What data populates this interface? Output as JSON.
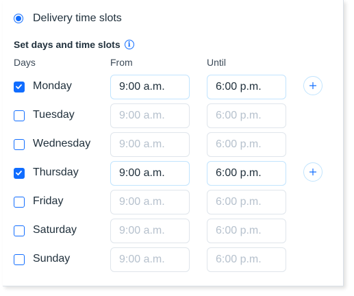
{
  "delivery": {
    "option_label": "Delivery time slots",
    "selected": true
  },
  "section": {
    "title": "Set days and time slots",
    "info_icon": "info-icon"
  },
  "columns": {
    "days": "Days",
    "from": "From",
    "until": "Until"
  },
  "days": [
    {
      "label": "Monday",
      "checked": true,
      "from": "9:00 a.m.",
      "until": "6:00 p.m."
    },
    {
      "label": "Tuesday",
      "checked": false,
      "from": "9:00 a.m.",
      "until": "6:00 p.m."
    },
    {
      "label": "Wednesday",
      "checked": false,
      "from": "9:00 a.m.",
      "until": "6:00 p.m."
    },
    {
      "label": "Thursday",
      "checked": true,
      "from": "9:00 a.m.",
      "until": "6:00 p.m."
    },
    {
      "label": "Friday",
      "checked": false,
      "from": "9:00 a.m.",
      "until": "6:00 p.m."
    },
    {
      "label": "Saturday",
      "checked": false,
      "from": "9:00 a.m.",
      "until": "6:00 p.m."
    },
    {
      "label": "Sunday",
      "checked": false,
      "from": "9:00 a.m.",
      "until": "6:00 p.m."
    }
  ],
  "colors": {
    "accent": "#116dff",
    "text": "#20303c",
    "disabled_text": "#b6c1cd",
    "input_border": "#c1e4fe",
    "disabled_border": "#dfe5eb"
  }
}
